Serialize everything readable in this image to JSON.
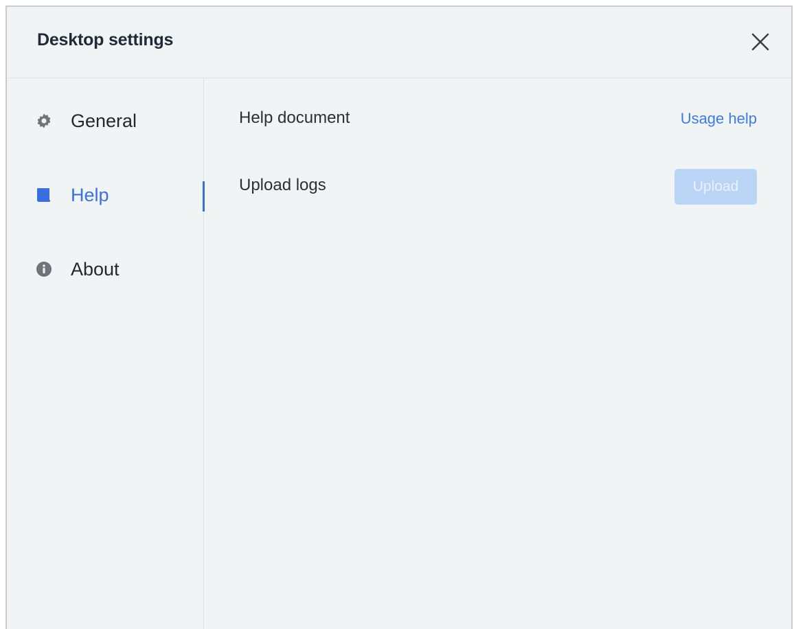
{
  "window": {
    "title": "Desktop settings",
    "close_icon": "close-icon"
  },
  "sidebar": {
    "items": [
      {
        "label": "General",
        "icon": "gear-icon",
        "active": false
      },
      {
        "label": "Help",
        "icon": "book-icon",
        "active": true
      },
      {
        "label": "About",
        "icon": "info-icon",
        "active": false
      }
    ]
  },
  "content": {
    "rows": [
      {
        "label": "Help document",
        "action_label": "Usage help",
        "action_type": "link"
      },
      {
        "label": "Upload logs",
        "action_label": "Upload",
        "action_type": "button-disabled"
      }
    ]
  },
  "colors": {
    "accent": "#3b6fe0",
    "link": "#3d7ce6",
    "background": "#f0f4f5",
    "disabled_button": "#b9d4f5"
  }
}
